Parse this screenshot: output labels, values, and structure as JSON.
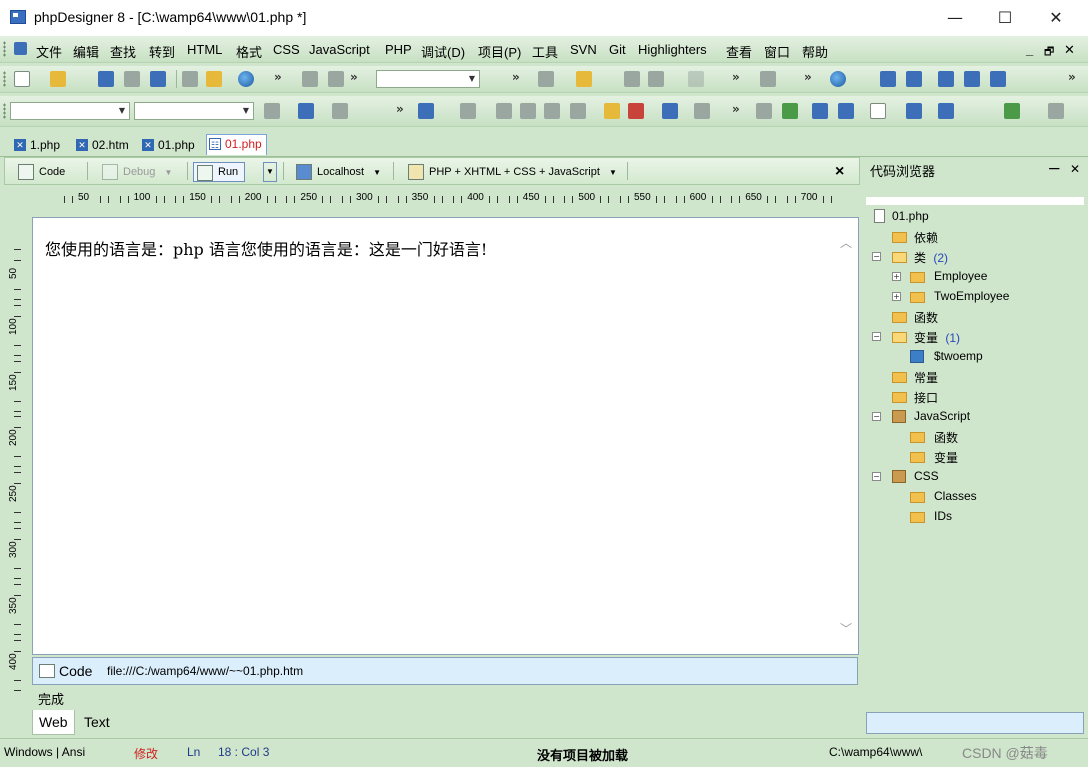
{
  "window": {
    "title": "phpDesigner 8 - [C:\\wamp64\\www\\01.php *]",
    "minimize": "—",
    "maximize": "☐",
    "close": "✕"
  },
  "menu": {
    "items": [
      "文件",
      "编辑",
      "查找",
      "转到",
      "HTML",
      "格式",
      "CSS",
      "JavaScript",
      "PHP",
      "调试(D)",
      "项目(P)",
      "工具",
      "SVN",
      "Git",
      "Highlighters",
      "查看",
      "窗口",
      "帮助"
    ],
    "mdi_controls": [
      "_",
      "🗗",
      "✕"
    ]
  },
  "tabs": [
    {
      "label": "1.php",
      "icon": "php-file-icon"
    },
    {
      "label": "02.htm",
      "icon": "html-file-icon"
    },
    {
      "label": "01.php",
      "icon": "php-file-icon"
    },
    {
      "label": "01.php",
      "icon": "php-file-icon-active",
      "active": true
    }
  ],
  "editor_toolbar": {
    "code": "Code",
    "debug": "Debug",
    "run": "Run",
    "localhost": "Localhost",
    "language": "PHP + XHTML + CSS + JavaScript",
    "close": "×"
  },
  "ruler": {
    "labels": [
      "50",
      "100",
      "150",
      "200",
      "250",
      "300",
      "350",
      "400",
      "450",
      "500",
      "550",
      "600",
      "650",
      "700"
    ],
    "vlabels": [
      "50",
      "100",
      "150",
      "200",
      "250",
      "300",
      "350",
      "400"
    ]
  },
  "editor": {
    "content": "您使用的语言是：php 语言您使用的语言是：这是一门好语言!"
  },
  "code_bar": {
    "label": "Code",
    "path": "file:///C:/wamp64/www/~~01.php.htm"
  },
  "done_text": "完成",
  "bottom_tabs": {
    "web": "Web",
    "text": "Text"
  },
  "code_browser": {
    "title": "代码浏览器",
    "pin": "ᅳ",
    "close": "✕",
    "tree": {
      "root": "01.php",
      "deps": "依赖",
      "classes": "类",
      "classes_count": "(2)",
      "class1": "Employee",
      "class2": "TwoEmployee",
      "functions": "函数",
      "variables": "变量",
      "variables_count": "(1)",
      "var1": "$twoemp",
      "constants": "常量",
      "interfaces": "接口",
      "javascript": "JavaScript",
      "js_functions": "函数",
      "js_variables": "变量",
      "css": "CSS",
      "css_classes": "Classes",
      "css_ids": "IDs"
    }
  },
  "status": {
    "encoding": "Windows | Ansi",
    "modified": "修改",
    "ln_label": "Ln",
    "position": "18 : Col   3",
    "project": "没有项目被加载",
    "path": "C:\\wamp64\\www\\",
    "watermark": "CSDN @菇毒"
  },
  "colors": {
    "ide_bg": "#cfe6cc",
    "active_tab_text": "#d02020",
    "modified_text": "#d02020",
    "count_text": "#2946b8"
  }
}
